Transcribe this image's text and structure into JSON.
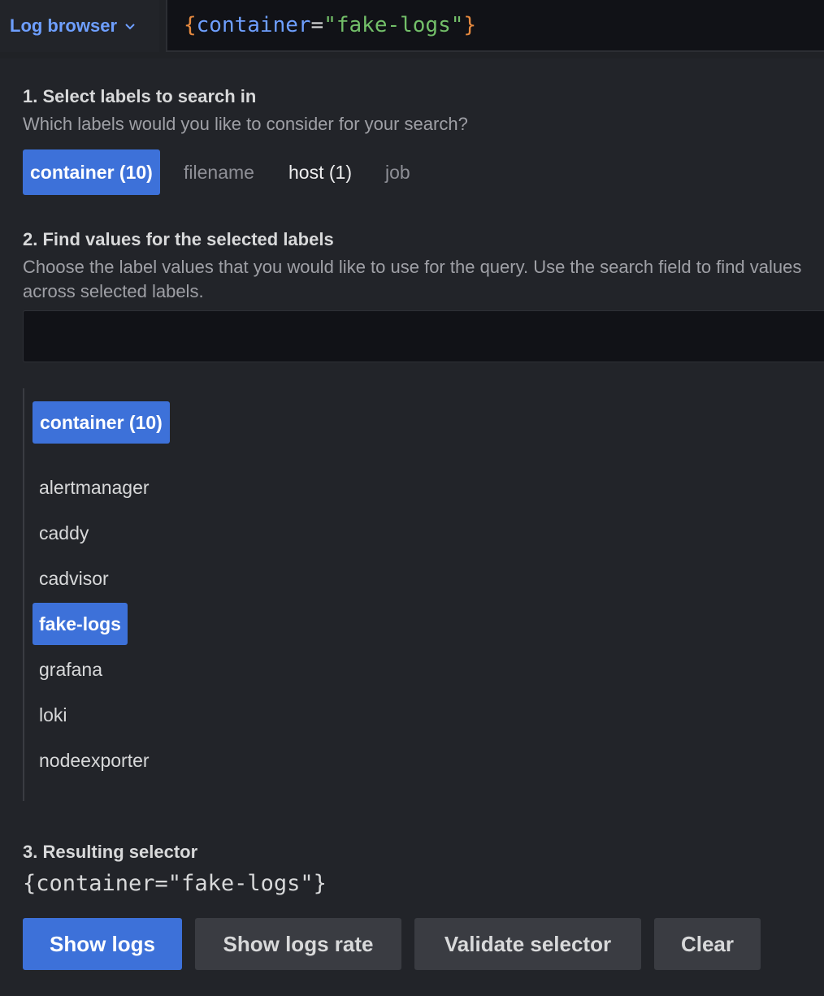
{
  "header": {
    "log_browser_label": "Log browser",
    "query": {
      "open_brace": "{",
      "key": "container",
      "equals": "=",
      "value": "\"fake-logs\"",
      "close_brace": "}"
    }
  },
  "step1": {
    "title": "1. Select labels to search in",
    "description": "Which labels would you like to consider for your search?",
    "labels": [
      {
        "label": "container (10)",
        "state": "selected"
      },
      {
        "label": "filename",
        "state": "muted"
      },
      {
        "label": "host (1)",
        "state": "active"
      },
      {
        "label": "job",
        "state": "muted"
      }
    ]
  },
  "step2": {
    "title": "2. Find values for the selected labels",
    "description": "Choose the label values that you would like to use for the query. Use the search field to find values across selected labels.",
    "search_value": "",
    "values_header": "container (10)",
    "values": [
      {
        "label": "alertmanager",
        "selected": false
      },
      {
        "label": "caddy",
        "selected": false
      },
      {
        "label": "cadvisor",
        "selected": false
      },
      {
        "label": "fake-logs",
        "selected": true
      },
      {
        "label": "grafana",
        "selected": false
      },
      {
        "label": "loki",
        "selected": false
      },
      {
        "label": "nodeexporter",
        "selected": false
      }
    ]
  },
  "step3": {
    "title": "3. Resulting selector",
    "selector": "{container=\"fake-logs\"}"
  },
  "buttons": {
    "show_logs": "Show logs",
    "show_logs_rate": "Show logs rate",
    "validate_selector": "Validate selector",
    "clear": "Clear"
  },
  "colors": {
    "accent": "#3d71d9",
    "link": "#6e9fff",
    "brace": "#e5893f",
    "string": "#73bf69"
  }
}
